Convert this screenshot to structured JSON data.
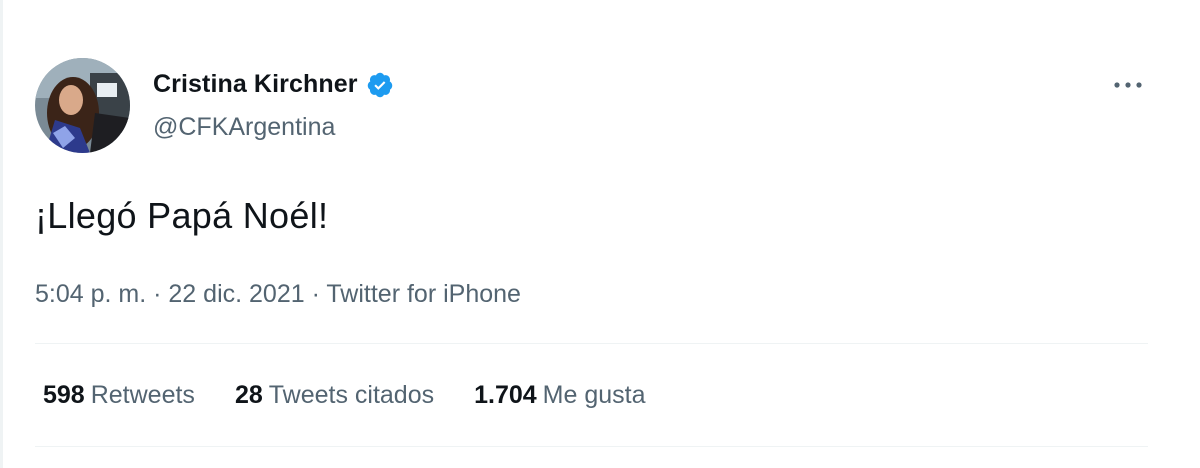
{
  "author": {
    "display_name": "Cristina Kirchner",
    "handle": "@CFKArgentina",
    "verified_icon": "verified-badge-icon",
    "avatar_icon": "profile-avatar"
  },
  "tweet": {
    "text": "¡Llegó Papá Noél!",
    "time": "5:04 p. m.",
    "separator": "·",
    "date": "22 dic. 2021",
    "source": "Twitter for iPhone"
  },
  "stats": [
    {
      "count": "598",
      "label": "Retweets"
    },
    {
      "count": "28",
      "label": "Tweets citados"
    },
    {
      "count": "1.704",
      "label": "Me gusta"
    }
  ],
  "colors": {
    "accent": "#1d9bf0",
    "text": "#0f1419",
    "secondary": "#536471",
    "divider": "#eff3f4"
  }
}
